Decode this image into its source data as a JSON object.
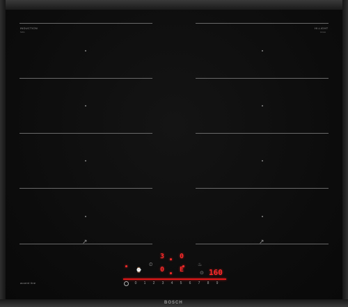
{
  "brand": "BOSCH",
  "top_left_label": "INDUCTION",
  "top_left_sublabel": "hobs",
  "top_right_label": "HI-LIGHT",
  "top_right_sublabel": "zones",
  "series_label": "accent",
  "series_label2": "line",
  "display": {
    "zone_upper_left": "3",
    "zone_upper_right": "0",
    "zone_lower_left": "0",
    "zone_lower_right": "E",
    "temperature": "160"
  },
  "scale": [
    "0",
    "1",
    "2",
    "3",
    "4",
    "5",
    "6",
    "7",
    "8",
    "9"
  ],
  "icons": {
    "power": "power-icon",
    "move_left": "move-icon",
    "move_right": "move-icon",
    "timer": "timer-icon",
    "lock": "lock-icon",
    "fry": "frying-sensor-icon"
  },
  "colors": {
    "glass": "#0e0e0e",
    "frame": "#2a2a2a",
    "indicator": "#ff2a2a",
    "zone_line": "#6a6a6a"
  }
}
